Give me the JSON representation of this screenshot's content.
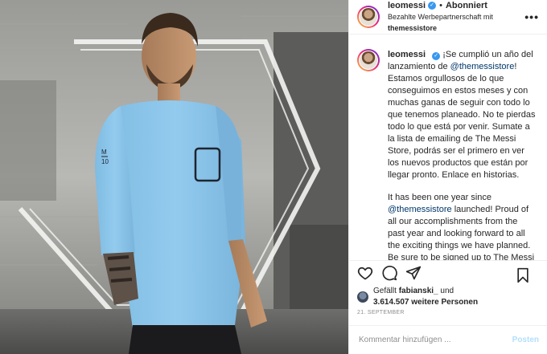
{
  "header": {
    "username": "leomessi",
    "separator": "•",
    "follow_status": "Abonniert",
    "paid_prefix": "Bezahlte Werbepartnerschaft mit",
    "partner": "themessistore",
    "more_icon": "more-horizontal-icon"
  },
  "caption": {
    "username": "leomessi",
    "es_part1": "¡Se cumplió un año del lanzamiento de ",
    "es_mention": "@themessistore",
    "es_part2": "! Estamos orgullosos de lo que conseguimos en estos meses y con muchas ganas de seguir con todo lo que tenemos planeado. No te pierdas todo lo que está por venir. Sumate a la lista de emailing de The Messi Store, podrás ser el primero en ver los nuevos productos que están por llegar pronto. Enlace en historias.",
    "en_part1": "It has been one year since ",
    "en_mention": "@themessistore",
    "en_part2": " launched! Proud of all our accomplishments from the past year and looking forward to all the exciting things we have planned. Be sure to be signed up to The Messi Store mailing list to be the first to find"
  },
  "actions": {
    "like_icon": "heart-icon",
    "comment_icon": "comment-icon",
    "share_icon": "send-icon",
    "save_icon": "bookmark-icon"
  },
  "likes": {
    "prefix": "Gefällt",
    "liker": "fabianski_",
    "conj": "und",
    "count": "3.614.507 weitere Personen"
  },
  "date": "21. SEPTEMBER",
  "comment": {
    "placeholder": "Kommentar hinzufügen ...",
    "post_label": "Posten"
  },
  "colors": {
    "accent_link": "#00376b",
    "verified": "#3897f0",
    "post_disabled": "#b2dffc",
    "shirt": "#8cc6ea"
  }
}
